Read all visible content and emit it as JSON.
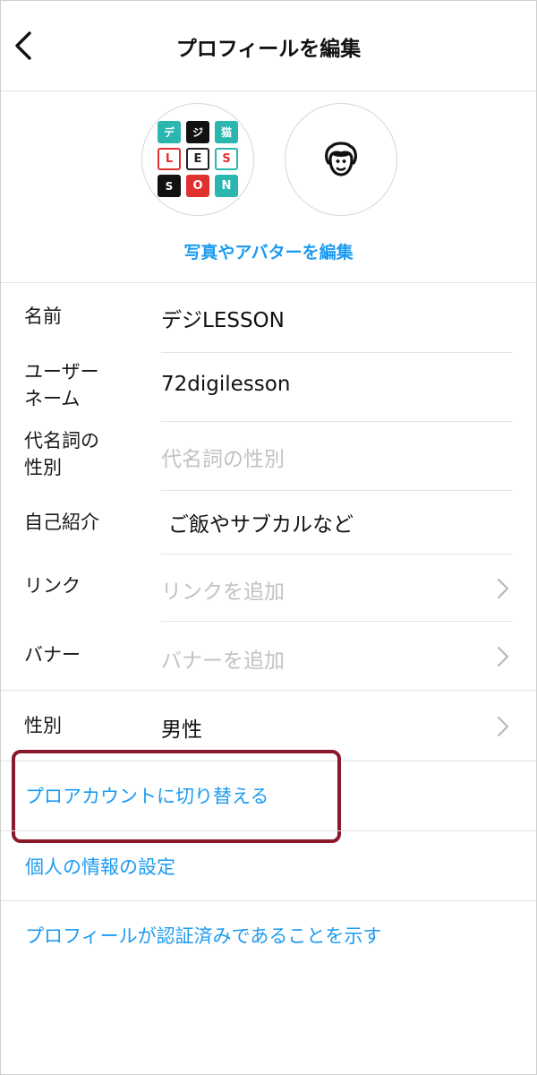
{
  "header": {
    "title": "プロフィールを編集",
    "back_icon": "chevron-left-icon"
  },
  "avatar_section": {
    "edit_link": "写真やアバターを編集",
    "logo_tiles": [
      "デ",
      "ジ",
      "猫",
      "L",
      "E",
      "S",
      "S",
      "O",
      "N"
    ],
    "avatar_icon": "avatar-face-icon"
  },
  "fields": {
    "name": {
      "label": "名前",
      "value": "デジLESSON"
    },
    "username": {
      "label_line1": "ユーザー",
      "label_line2": "ネーム",
      "value": "72digilesson"
    },
    "pronouns": {
      "label_line1": "代名詞の",
      "label_line2": "性別",
      "placeholder": "代名詞の性別"
    },
    "bio": {
      "label": "自己紹介",
      "value": "ご飯やサブカルなど"
    },
    "link": {
      "label": "リンク",
      "placeholder": "リンクを追加"
    },
    "banner": {
      "label": "バナー",
      "placeholder": "バナーを追加"
    },
    "gender": {
      "label": "性別",
      "value": "男性"
    }
  },
  "actions": {
    "switch_pro": "プロアカウントに切り替える",
    "personal_info": "個人の情報の設定",
    "verified": "プロフィールが認証済みであることを示す"
  },
  "colors": {
    "link_blue": "#1d9bf0",
    "highlight_border": "#8a1a2b",
    "placeholder_gray": "#c2c2c2",
    "divider": "#e3e3e3"
  }
}
